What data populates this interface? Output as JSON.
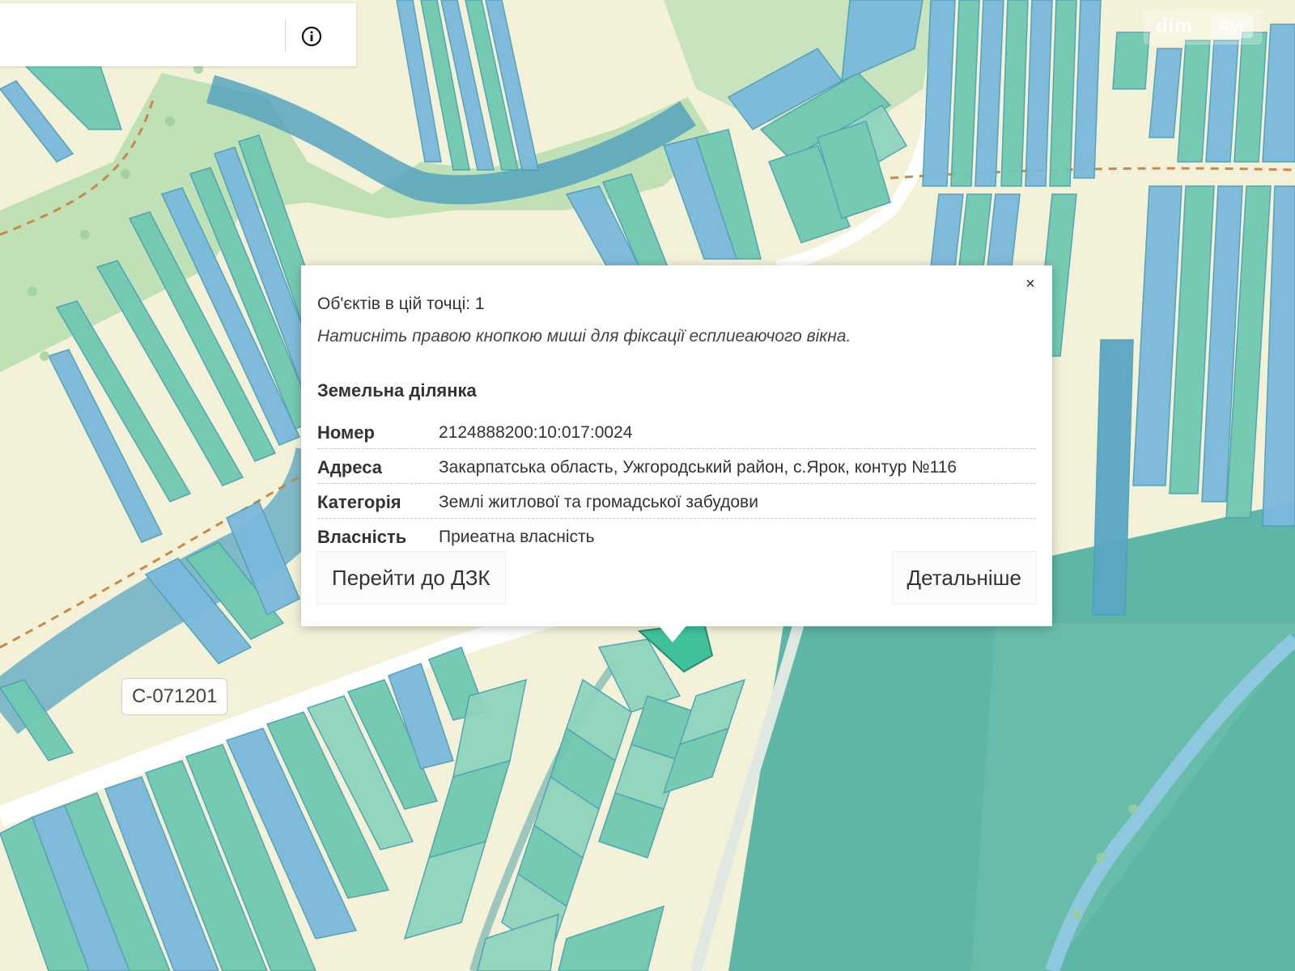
{
  "search": {
    "value": "",
    "placeholder": ""
  },
  "info_icon": "info-circle-icon",
  "watermark": {
    "brand": "dim",
    "badge": "RIA"
  },
  "road_label": "C-071201",
  "popup": {
    "count_text": "Об'єктів в цій точці: 1",
    "hint_text": "Натисніть правою кнопкою миші для фіксації есплиеаючого вікна.",
    "section_title": "Земельна ділянка",
    "rows": [
      {
        "key": "Номер",
        "value": "2124888200:10:017:0024"
      },
      {
        "key": "Адреса",
        "value": "Закарпатська область, Ужгородський район, с.Ярок, контур №116"
      },
      {
        "key": "Категорія",
        "value": "Землі житлової та громадської забудови"
      },
      {
        "key": "Власність",
        "value": "Приеатна власність"
      }
    ],
    "btn_dzk": "Перейти до ДЗК",
    "btn_details": "Детальніше",
    "close_glyph": "×"
  },
  "colors": {
    "land_background": "#f3f2d8",
    "forest_green": "#a9d6a8",
    "parcel_teal": "#7fd1bb",
    "parcel_blue": "#8cc8df",
    "forest_dark": "#5fb8aa",
    "river": "#6fb2d0",
    "road": "#ffffff",
    "selected_parcel": "#3fc29c"
  }
}
